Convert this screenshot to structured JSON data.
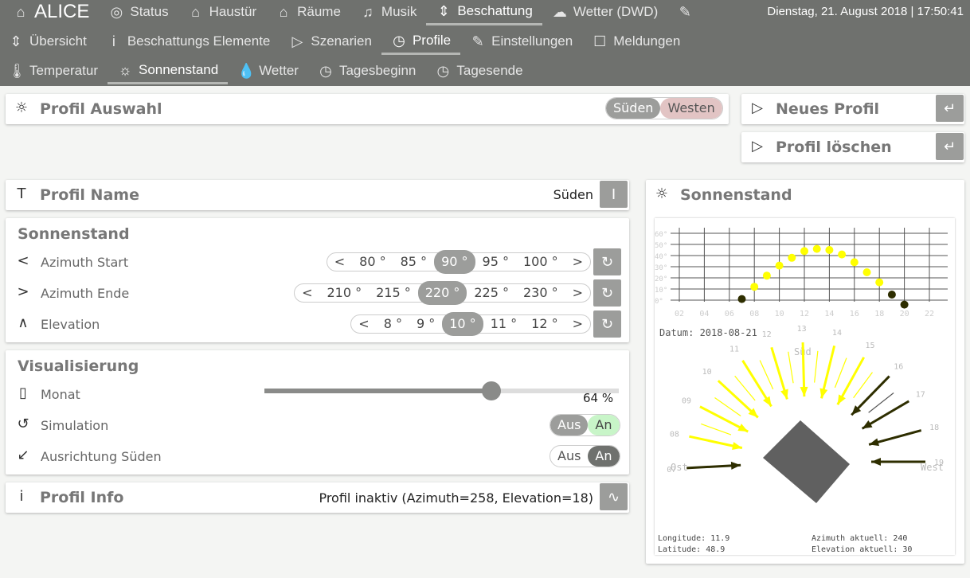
{
  "header": {
    "brand": "ALICE",
    "datetime": "Dienstag, 21. August 2018 | 17:50:41",
    "nav1": [
      {
        "label": "Status",
        "icon": "eye-icon"
      },
      {
        "label": "Haustür",
        "icon": "garage-icon"
      },
      {
        "label": "Räume",
        "icon": "home-icon"
      },
      {
        "label": "Musik",
        "icon": "music-icon"
      },
      {
        "label": "Beschattung",
        "icon": "shade-icon",
        "active": true
      },
      {
        "label": "Wetter (DWD)",
        "icon": "cloud-icon"
      },
      {
        "label": "",
        "icon": "wrench-icon"
      }
    ],
    "nav2": [
      {
        "label": "Übersicht",
        "icon": "shade-icon"
      },
      {
        "label": "Beschattungs Elemente",
        "icon": "info-icon"
      },
      {
        "label": "Szenarien",
        "icon": "play-icon"
      },
      {
        "label": "Profile",
        "icon": "clock-icon",
        "active": true
      },
      {
        "label": "Einstellungen",
        "icon": "wrench-icon"
      },
      {
        "label": "Meldungen",
        "icon": "message-icon"
      }
    ],
    "nav3": [
      {
        "label": "Temperatur",
        "icon": "thermometer-icon"
      },
      {
        "label": "Sonnenstand",
        "icon": "sun-icon",
        "active": true
      },
      {
        "label": "Wetter",
        "icon": "drop-icon"
      },
      {
        "label": "Tagesbeginn",
        "icon": "clock-icon"
      },
      {
        "label": "Tagesende",
        "icon": "clock-icon"
      }
    ]
  },
  "profil_auswahl": {
    "title": "Profil Auswahl",
    "options": [
      "Süden",
      "Westen"
    ],
    "selected": "Süden"
  },
  "actions": {
    "new": "Neues Profil",
    "delete": "Profil löschen"
  },
  "profil_name": {
    "title": "Profil Name",
    "value": "Süden"
  },
  "sonnenstand": {
    "title": "Sonnenstand",
    "azimuth_start": {
      "label": "Azimuth Start",
      "options": [
        "<",
        "80 °",
        "85 °",
        "90 °",
        "95 °",
        "100 °",
        ">"
      ],
      "selected": "90 °"
    },
    "azimuth_ende": {
      "label": "Azimuth Ende",
      "options": [
        "<",
        "210 °",
        "215 °",
        "220 °",
        "225 °",
        "230 °",
        ">"
      ],
      "selected": "220 °"
    },
    "elevation": {
      "label": "Elevation",
      "options": [
        "<",
        "8 °",
        "9 °",
        "10 °",
        "11 °",
        "12 °",
        ">"
      ],
      "selected": "10 °"
    }
  },
  "visualisierung": {
    "title": "Visualisierung",
    "monat": {
      "label": "Monat",
      "value_percent": 64,
      "value_text": "64 %"
    },
    "simulation": {
      "label": "Simulation",
      "off": "Aus",
      "on": "An",
      "state": "An"
    },
    "ausrichtung": {
      "label": "Ausrichtung Süden",
      "off": "Aus",
      "on": "An",
      "state": "An"
    }
  },
  "profil_info": {
    "title": "Profil Info",
    "text": "Profil inaktiv (Azimuth=258, Elevation=18)"
  },
  "sonnen_panel": {
    "title": "Sonnenstand",
    "datum": "Datum: 2018-08-21",
    "sued": "Süd",
    "ost": "Ost",
    "west": "West",
    "longitude": "Longitude: 11.9",
    "latitude": "Latitude: 48.9",
    "azimuth": "Azimuth aktuell: 240",
    "elevation": "Elevation aktuell: 30"
  },
  "chart_data": {
    "type": "scatter",
    "x_ticks": [
      "02",
      "04",
      "06",
      "08",
      "10",
      "12",
      "14",
      "16",
      "18",
      "20",
      "22"
    ],
    "y_ticks": [
      "0°",
      "10°",
      "20°",
      "30°",
      "40°",
      "50°",
      "60°"
    ],
    "ylim": [
      0,
      60
    ],
    "xlim": [
      0,
      24
    ],
    "grid": true,
    "colors": {
      "active": "#ffff00",
      "inactive": "#2e2e00"
    },
    "points": [
      {
        "x": 7,
        "y": 1,
        "active": false
      },
      {
        "x": 8,
        "y": 12,
        "active": true
      },
      {
        "x": 9,
        "y": 22,
        "active": true
      },
      {
        "x": 10,
        "y": 31,
        "active": true
      },
      {
        "x": 11,
        "y": 38,
        "active": true
      },
      {
        "x": 12,
        "y": 44,
        "active": true
      },
      {
        "x": 13,
        "y": 46,
        "active": true
      },
      {
        "x": 14,
        "y": 45,
        "active": true
      },
      {
        "x": 15,
        "y": 41,
        "active": true
      },
      {
        "x": 16,
        "y": 34,
        "active": true
      },
      {
        "x": 17,
        "y": 25,
        "active": true
      },
      {
        "x": 18,
        "y": 16,
        "active": true
      },
      {
        "x": 19,
        "y": 5,
        "active": false
      },
      {
        "x": 20,
        "y": -4,
        "active": false
      }
    ],
    "compass_hours": [
      {
        "h": "07",
        "active": false
      },
      {
        "h": "08",
        "active": true
      },
      {
        "h": "09",
        "active": true
      },
      {
        "h": "10",
        "active": true
      },
      {
        "h": "11",
        "active": true
      },
      {
        "h": "12",
        "active": true
      },
      {
        "h": "13",
        "active": true
      },
      {
        "h": "14",
        "active": true
      },
      {
        "h": "15",
        "active": true
      },
      {
        "h": "16",
        "active": false
      },
      {
        "h": "17",
        "active": false
      },
      {
        "h": "18",
        "active": false
      },
      {
        "h": "19",
        "active": false
      }
    ]
  }
}
